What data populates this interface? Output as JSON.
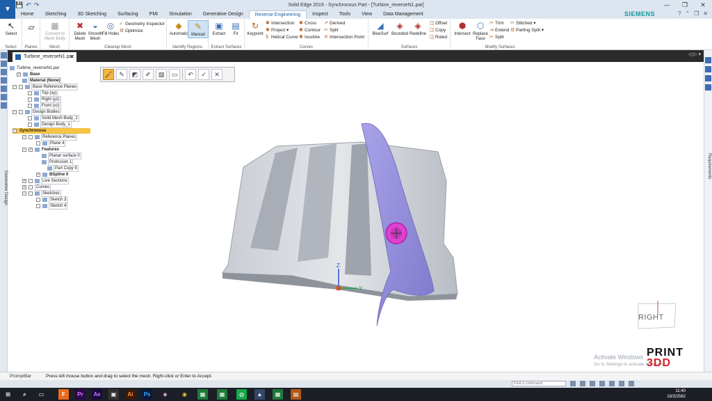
{
  "window": {
    "title": "Solid Edge 2019 - Synchronous Part - [Turbine_reverseN1.par]",
    "buttons": [
      "—",
      "❐",
      "✕"
    ]
  },
  "ribbon_tabs": [
    {
      "label": "Home"
    },
    {
      "label": "Sketching"
    },
    {
      "label": "3D Sketching"
    },
    {
      "label": "Surfacing"
    },
    {
      "label": "PMI"
    },
    {
      "label": "Simulation"
    },
    {
      "label": "Generative Design"
    },
    {
      "label": "Reverse Engineering",
      "active": true
    },
    {
      "label": "Inspect"
    },
    {
      "label": "Tools"
    },
    {
      "label": "View"
    },
    {
      "label": "Data Management"
    }
  ],
  "brand": "SIEMENS",
  "ribbon": {
    "groups": [
      {
        "label": "Select"
      },
      {
        "label": "Planes"
      },
      {
        "label": "Mesh"
      },
      {
        "label": "Cleanup Mesh"
      },
      {
        "label": "Identify Regions"
      },
      {
        "label": "Extract Surfaces"
      },
      {
        "label": "Curves"
      },
      {
        "label": "Surfaces"
      },
      {
        "label": "Modify Surfaces"
      }
    ],
    "select": "Select",
    "convert": "Convert to Mesh Body",
    "delete_mesh": "Delete Mesh",
    "smooth_mesh": "Smooth Mesh",
    "fill_holes": "Fill Holes",
    "geometry_inspector": "Geometry Inspector",
    "optimize": "Optimize",
    "automatic": "Automatic",
    "manual": "Manual",
    "extract": "Extract",
    "fit": "Fit",
    "keypoint": "Keypoint",
    "intersection": "Intersection",
    "project": "Project",
    "helical_curve": "Helical Curve",
    "cross": "Cross",
    "contour": "Contour",
    "isocline": "Isocline",
    "derived": "Derived",
    "split_curve": "Split",
    "intersection_point": "Intersection Point",
    "bluesurf": "BlueSurf",
    "bounded": "Bounded",
    "redefine": "Redefine",
    "offset": "Offset",
    "copy": "Copy",
    "ruled": "Ruled",
    "intersect": "Intersect",
    "replace_face": "Replace Face",
    "trim": "Trim",
    "extend": "Extend",
    "split_surface": "Split",
    "stitched": "Stitched",
    "parting_split": "Parting Split"
  },
  "document_tab": "Turbine_reverseN1.par",
  "left_strip_label": "Generative Design",
  "right_strip_label": "Requirements",
  "tree": [
    {
      "label": "Turbine_reverseN1.par",
      "bold": false
    },
    {
      "label": "Base",
      "bold": true
    },
    {
      "label": "Material (None)",
      "bold": true
    },
    {
      "label": "Base Reference Planes"
    },
    {
      "label": "Top (xy)"
    },
    {
      "label": "Right (yz)"
    },
    {
      "label": "Front (xz)"
    },
    {
      "label": "Design Bodies"
    },
    {
      "label": "Solid Mesh Body_2"
    },
    {
      "label": "Design Body_1"
    },
    {
      "label": "Synchronous"
    },
    {
      "label": "Reference Planes"
    },
    {
      "label": "Plane 4"
    },
    {
      "label": "Features",
      "bold": true
    },
    {
      "label": "Planar surface 0"
    },
    {
      "label": "Protrusion 1"
    },
    {
      "label": "Part Copy 9"
    },
    {
      "label": "BSpline 0",
      "bold": true
    },
    {
      "label": "Live Sections"
    },
    {
      "label": "Curves"
    },
    {
      "label": "Sketches"
    },
    {
      "label": "Sketch 3"
    },
    {
      "label": "Sketch 4"
    }
  ],
  "axes": {
    "z": "Z",
    "y": "Y"
  },
  "viewcube": "RIGHT",
  "watermark": {
    "line1": "Activate Windows",
    "line2": "Go to Settings to activate Windows."
  },
  "logo": {
    "line1": "PRINT",
    "line2": "3DD"
  },
  "prompt": {
    "label": "PromptBar",
    "message": "Press left mouse button and drag to select the mesh. Right-click or Enter to Accept."
  },
  "find_command_placeholder": "Find a command",
  "clock": {
    "time": "11:40",
    "date": "18/3/2562"
  },
  "taskbar_apps": [
    "F",
    "Pr",
    "Ae",
    "Ps",
    "Ai"
  ],
  "colors": {
    "accent": "#1d5fa8",
    "highlight": "#f7c545",
    "surface": "#8f8ad8",
    "keypoint": "#e040d0"
  }
}
